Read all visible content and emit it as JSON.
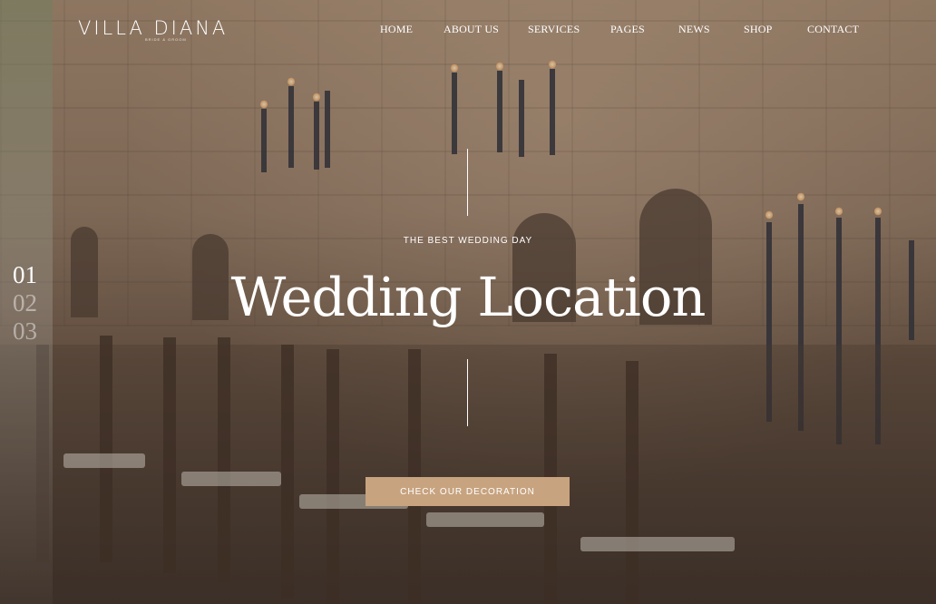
{
  "brand": {
    "logo": "VILLA DIANA",
    "logo_sub": "BRIDE & GROOM"
  },
  "nav": {
    "items": [
      "HOME",
      "ABOUT US",
      "SERVICES",
      "PAGES",
      "NEWS",
      "SHOP",
      "CONTACT"
    ]
  },
  "slider": {
    "numbers": [
      "01",
      "02",
      "03"
    ],
    "active_index": 0
  },
  "hero": {
    "kicker": "THE BEST WEDDING DAY",
    "title": "Wedding Location",
    "cta_label": "CHECK OUR DECORATION"
  },
  "colors": {
    "accent": "#c7a37f",
    "text": "#ffffff"
  }
}
